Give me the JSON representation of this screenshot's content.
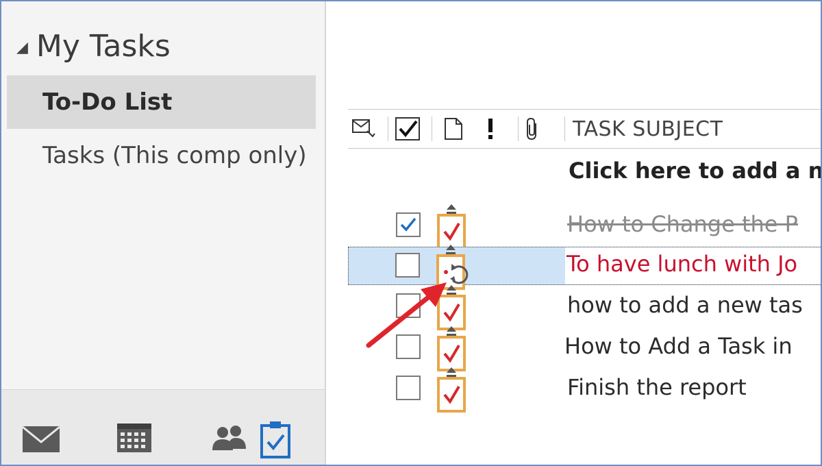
{
  "nav": {
    "header": "My Tasks",
    "items": [
      {
        "label": "To-Do List",
        "selected": true
      },
      {
        "label": "Tasks (This comp only)",
        "selected": false
      }
    ],
    "modules": [
      "mail-icon",
      "calendar-icon",
      "people-icon",
      "tasks-icon"
    ]
  },
  "list": {
    "columns": {
      "subject": "TASK SUBJECT"
    },
    "add_placeholder": "Click here to add a ne",
    "tasks": [
      {
        "subject": "How to Change the P",
        "completed": true
      },
      {
        "subject": "To have lunch with Jo",
        "completed": false,
        "selected": true,
        "recurring": true
      },
      {
        "subject": "how to add a new tas",
        "completed": false
      },
      {
        "subject": "How to Add a Task in",
        "completed": false
      },
      {
        "subject": "Finish the report",
        "completed": false
      }
    ]
  },
  "colors": {
    "accent": "#1f6fc4",
    "task_icon_orange": "#e8a74a",
    "check_red": "#d6282b",
    "selected_row": "#cfe3f6",
    "overdue_text": "#c8102e"
  }
}
